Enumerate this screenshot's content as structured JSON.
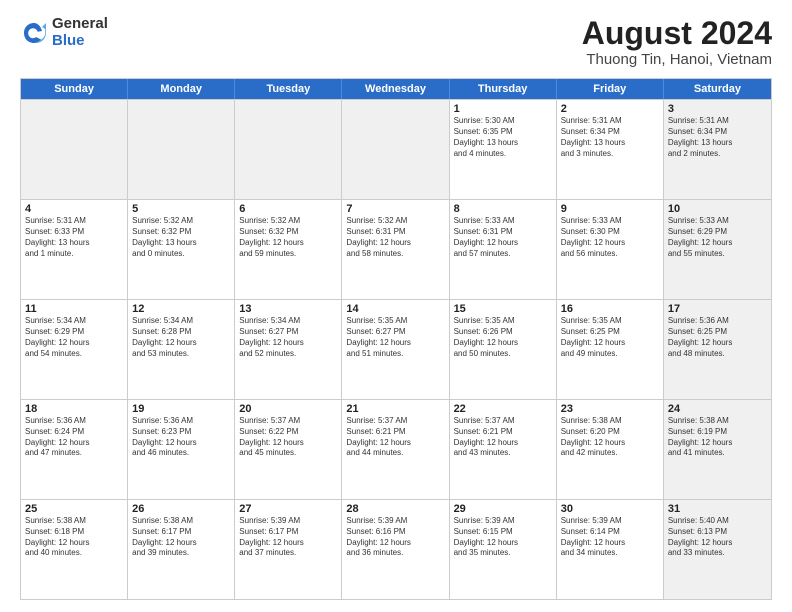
{
  "logo": {
    "general": "General",
    "blue": "Blue"
  },
  "title": "August 2024",
  "subtitle": "Thuong Tin, Hanoi, Vietnam",
  "headers": [
    "Sunday",
    "Monday",
    "Tuesday",
    "Wednesday",
    "Thursday",
    "Friday",
    "Saturday"
  ],
  "weeks": [
    [
      {
        "day": "",
        "info": "",
        "shaded": true
      },
      {
        "day": "",
        "info": "",
        "shaded": true
      },
      {
        "day": "",
        "info": "",
        "shaded": true
      },
      {
        "day": "",
        "info": "",
        "shaded": true
      },
      {
        "day": "1",
        "info": "Sunrise: 5:30 AM\nSunset: 6:35 PM\nDaylight: 13 hours\nand 4 minutes.",
        "shaded": false
      },
      {
        "day": "2",
        "info": "Sunrise: 5:31 AM\nSunset: 6:34 PM\nDaylight: 13 hours\nand 3 minutes.",
        "shaded": false
      },
      {
        "day": "3",
        "info": "Sunrise: 5:31 AM\nSunset: 6:34 PM\nDaylight: 13 hours\nand 2 minutes.",
        "shaded": true
      }
    ],
    [
      {
        "day": "4",
        "info": "Sunrise: 5:31 AM\nSunset: 6:33 PM\nDaylight: 13 hours\nand 1 minute.",
        "shaded": false
      },
      {
        "day": "5",
        "info": "Sunrise: 5:32 AM\nSunset: 6:32 PM\nDaylight: 13 hours\nand 0 minutes.",
        "shaded": false
      },
      {
        "day": "6",
        "info": "Sunrise: 5:32 AM\nSunset: 6:32 PM\nDaylight: 12 hours\nand 59 minutes.",
        "shaded": false
      },
      {
        "day": "7",
        "info": "Sunrise: 5:32 AM\nSunset: 6:31 PM\nDaylight: 12 hours\nand 58 minutes.",
        "shaded": false
      },
      {
        "day": "8",
        "info": "Sunrise: 5:33 AM\nSunset: 6:31 PM\nDaylight: 12 hours\nand 57 minutes.",
        "shaded": false
      },
      {
        "day": "9",
        "info": "Sunrise: 5:33 AM\nSunset: 6:30 PM\nDaylight: 12 hours\nand 56 minutes.",
        "shaded": false
      },
      {
        "day": "10",
        "info": "Sunrise: 5:33 AM\nSunset: 6:29 PM\nDaylight: 12 hours\nand 55 minutes.",
        "shaded": true
      }
    ],
    [
      {
        "day": "11",
        "info": "Sunrise: 5:34 AM\nSunset: 6:29 PM\nDaylight: 12 hours\nand 54 minutes.",
        "shaded": false
      },
      {
        "day": "12",
        "info": "Sunrise: 5:34 AM\nSunset: 6:28 PM\nDaylight: 12 hours\nand 53 minutes.",
        "shaded": false
      },
      {
        "day": "13",
        "info": "Sunrise: 5:34 AM\nSunset: 6:27 PM\nDaylight: 12 hours\nand 52 minutes.",
        "shaded": false
      },
      {
        "day": "14",
        "info": "Sunrise: 5:35 AM\nSunset: 6:27 PM\nDaylight: 12 hours\nand 51 minutes.",
        "shaded": false
      },
      {
        "day": "15",
        "info": "Sunrise: 5:35 AM\nSunset: 6:26 PM\nDaylight: 12 hours\nand 50 minutes.",
        "shaded": false
      },
      {
        "day": "16",
        "info": "Sunrise: 5:35 AM\nSunset: 6:25 PM\nDaylight: 12 hours\nand 49 minutes.",
        "shaded": false
      },
      {
        "day": "17",
        "info": "Sunrise: 5:36 AM\nSunset: 6:25 PM\nDaylight: 12 hours\nand 48 minutes.",
        "shaded": true
      }
    ],
    [
      {
        "day": "18",
        "info": "Sunrise: 5:36 AM\nSunset: 6:24 PM\nDaylight: 12 hours\nand 47 minutes.",
        "shaded": false
      },
      {
        "day": "19",
        "info": "Sunrise: 5:36 AM\nSunset: 6:23 PM\nDaylight: 12 hours\nand 46 minutes.",
        "shaded": false
      },
      {
        "day": "20",
        "info": "Sunrise: 5:37 AM\nSunset: 6:22 PM\nDaylight: 12 hours\nand 45 minutes.",
        "shaded": false
      },
      {
        "day": "21",
        "info": "Sunrise: 5:37 AM\nSunset: 6:21 PM\nDaylight: 12 hours\nand 44 minutes.",
        "shaded": false
      },
      {
        "day": "22",
        "info": "Sunrise: 5:37 AM\nSunset: 6:21 PM\nDaylight: 12 hours\nand 43 minutes.",
        "shaded": false
      },
      {
        "day": "23",
        "info": "Sunrise: 5:38 AM\nSunset: 6:20 PM\nDaylight: 12 hours\nand 42 minutes.",
        "shaded": false
      },
      {
        "day": "24",
        "info": "Sunrise: 5:38 AM\nSunset: 6:19 PM\nDaylight: 12 hours\nand 41 minutes.",
        "shaded": true
      }
    ],
    [
      {
        "day": "25",
        "info": "Sunrise: 5:38 AM\nSunset: 6:18 PM\nDaylight: 12 hours\nand 40 minutes.",
        "shaded": false
      },
      {
        "day": "26",
        "info": "Sunrise: 5:38 AM\nSunset: 6:17 PM\nDaylight: 12 hours\nand 39 minutes.",
        "shaded": false
      },
      {
        "day": "27",
        "info": "Sunrise: 5:39 AM\nSunset: 6:17 PM\nDaylight: 12 hours\nand 37 minutes.",
        "shaded": false
      },
      {
        "day": "28",
        "info": "Sunrise: 5:39 AM\nSunset: 6:16 PM\nDaylight: 12 hours\nand 36 minutes.",
        "shaded": false
      },
      {
        "day": "29",
        "info": "Sunrise: 5:39 AM\nSunset: 6:15 PM\nDaylight: 12 hours\nand 35 minutes.",
        "shaded": false
      },
      {
        "day": "30",
        "info": "Sunrise: 5:39 AM\nSunset: 6:14 PM\nDaylight: 12 hours\nand 34 minutes.",
        "shaded": false
      },
      {
        "day": "31",
        "info": "Sunrise: 5:40 AM\nSunset: 6:13 PM\nDaylight: 12 hours\nand 33 minutes.",
        "shaded": true
      }
    ]
  ]
}
